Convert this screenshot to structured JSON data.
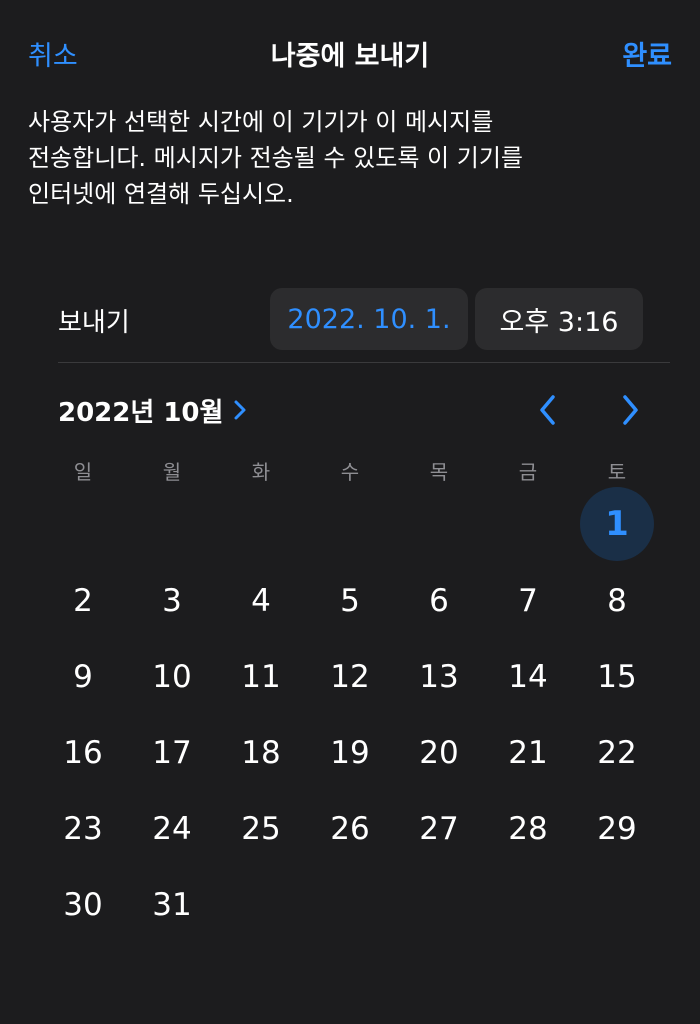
{
  "nav": {
    "cancel_label": "취소",
    "title": "나중에 보내기",
    "done_label": "완료"
  },
  "description": {
    "line1": "사용자가 선택한 시간에 이 기기가 이 메시지를",
    "line2": "전송합니다. 메시지가 전송될 수 있도록 이 기기를",
    "line3": "인터넷에 연결해 두십시오."
  },
  "send": {
    "label": "보내기",
    "date": "2022. 10. 1.",
    "time": "오후 3:16"
  },
  "calendar": {
    "month_label": "2022년 10월",
    "weekdays": [
      "일",
      "월",
      "화",
      "수",
      "목",
      "금",
      "토"
    ],
    "first_weekday_index": 6,
    "days": [
      "1",
      "2",
      "3",
      "4",
      "5",
      "6",
      "7",
      "8",
      "9",
      "10",
      "11",
      "12",
      "13",
      "14",
      "15",
      "16",
      "17",
      "18",
      "19",
      "20",
      "21",
      "22",
      "23",
      "24",
      "25",
      "26",
      "27",
      "28",
      "29",
      "30",
      "31"
    ],
    "selected_day": "1"
  },
  "colors": {
    "background": "#1c1c1e",
    "accent": "#2f8fff",
    "pill": "#2c2c2e",
    "selected_circle": "#1a2f47",
    "weekday_text": "#8e8e93"
  },
  "icons": {
    "month_chevron": "chevron-right-icon",
    "prev": "chevron-left-icon",
    "next": "chevron-right-icon"
  }
}
